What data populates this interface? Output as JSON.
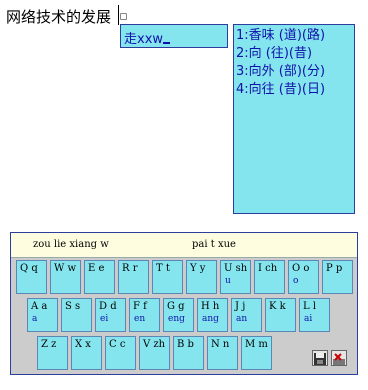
{
  "document": {
    "text": "网络技术的发展"
  },
  "composition": {
    "text": "走xxw"
  },
  "candidates": [
    "1:香味 (道)(路)",
    "2:向 (往)(昔)",
    "3:向外 (部)(分)",
    "4:向往 (昔)(日)"
  ],
  "keyboard": {
    "pinyin_strip_left": "zou lie xiang w",
    "pinyin_strip_right": "pai t xue",
    "rows": [
      [
        {
          "label": "Q q",
          "final": ""
        },
        {
          "label": "W w",
          "final": ""
        },
        {
          "label": "E e",
          "final": ""
        },
        {
          "label": "R r",
          "final": ""
        },
        {
          "label": "T t",
          "final": ""
        },
        {
          "label": "Y y",
          "final": ""
        },
        {
          "label": "U sh",
          "final": "u"
        },
        {
          "label": "I ch",
          "final": ""
        },
        {
          "label": "O o",
          "final": "o"
        },
        {
          "label": "P p",
          "final": ""
        }
      ],
      [
        {
          "label": "A a",
          "final": "a"
        },
        {
          "label": "S s",
          "final": ""
        },
        {
          "label": "D d",
          "final": "ei"
        },
        {
          "label": "F f",
          "final": "en"
        },
        {
          "label": "G g",
          "final": "eng"
        },
        {
          "label": "H h",
          "final": "ang"
        },
        {
          "label": "J j",
          "final": "an"
        },
        {
          "label": "K k",
          "final": ""
        },
        {
          "label": "L l",
          "final": "ai"
        }
      ],
      [
        {
          "label": "Z z",
          "final": ""
        },
        {
          "label": "X x",
          "final": ""
        },
        {
          "label": "C c",
          "final": ""
        },
        {
          "label": "V zh",
          "final": ""
        },
        {
          "label": "B b",
          "final": ""
        },
        {
          "label": "N n",
          "final": ""
        },
        {
          "label": "M m",
          "final": ""
        }
      ]
    ],
    "utility_icons": [
      "save-icon",
      "clear-icon"
    ]
  },
  "colors": {
    "panel": "#84e5ee",
    "border": "#2c3d9c",
    "text_blue": "#1111aa",
    "keyboard_bg": "#cccccc",
    "strip_bg": "#fffde0"
  }
}
